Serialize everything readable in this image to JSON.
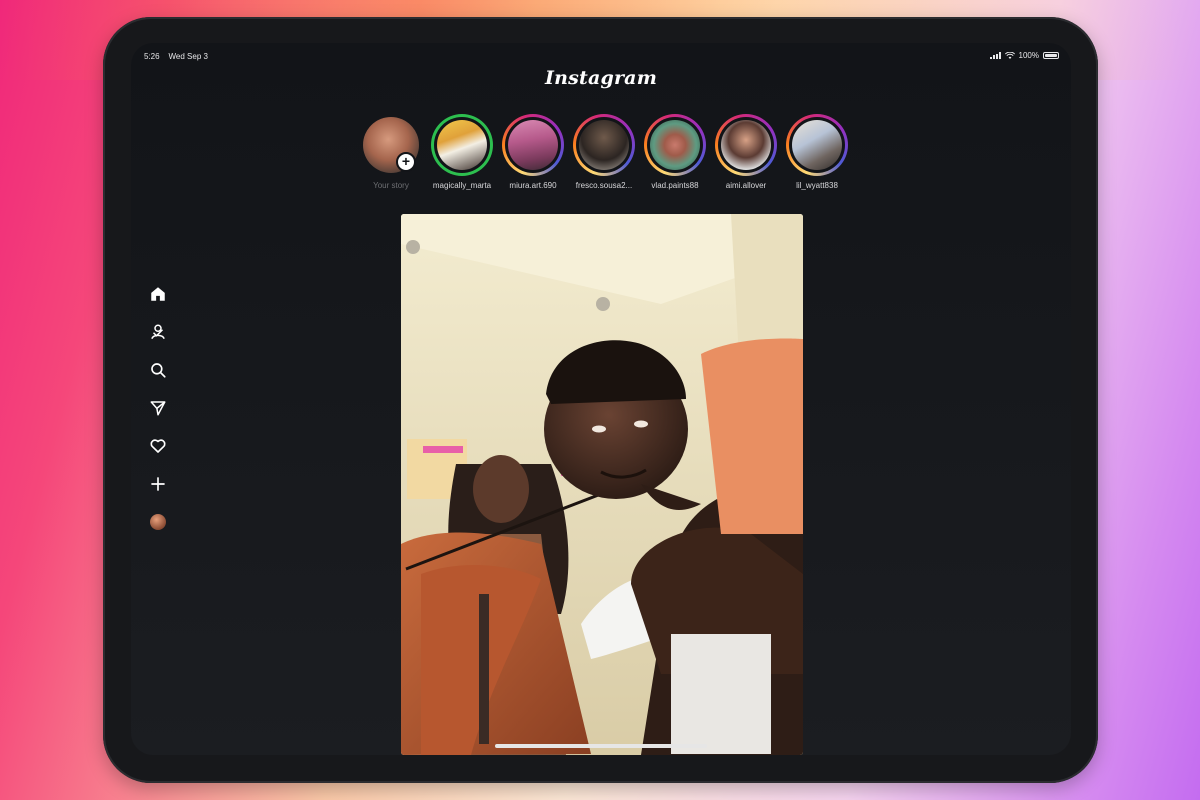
{
  "status_bar": {
    "time": "5:26",
    "date": "Wed Sep 3",
    "battery": "100%"
  },
  "app": {
    "title": "Instagram"
  },
  "stories": [
    {
      "username": "Your story",
      "is_own": true
    },
    {
      "username": "magically_marta",
      "ring": "close-friends"
    },
    {
      "username": "miura.art.690",
      "ring": "gradient"
    },
    {
      "username": "fresco.sousa2...",
      "ring": "gradient"
    },
    {
      "username": "vlad.paints88",
      "ring": "gradient"
    },
    {
      "username": "aimi.allover",
      "ring": "gradient"
    },
    {
      "username": "lil_wyatt838",
      "ring": "gradient"
    }
  ],
  "sidebar": {
    "items": [
      {
        "icon": "home-icon"
      },
      {
        "icon": "people-icon"
      },
      {
        "icon": "search-icon"
      },
      {
        "icon": "send-icon"
      },
      {
        "icon": "heart-icon"
      },
      {
        "icon": "plus-icon"
      },
      {
        "icon": "profile-avatar"
      }
    ]
  },
  "post": {
    "media": "photo of cellist and person leaning over camera"
  },
  "colors": {
    "screen_bg": "#121418",
    "story_gradient": [
      "#feda75",
      "#fa7e1e",
      "#d62976",
      "#962fbf",
      "#4f5bd5"
    ],
    "close_friends": "#2dbf4f"
  }
}
